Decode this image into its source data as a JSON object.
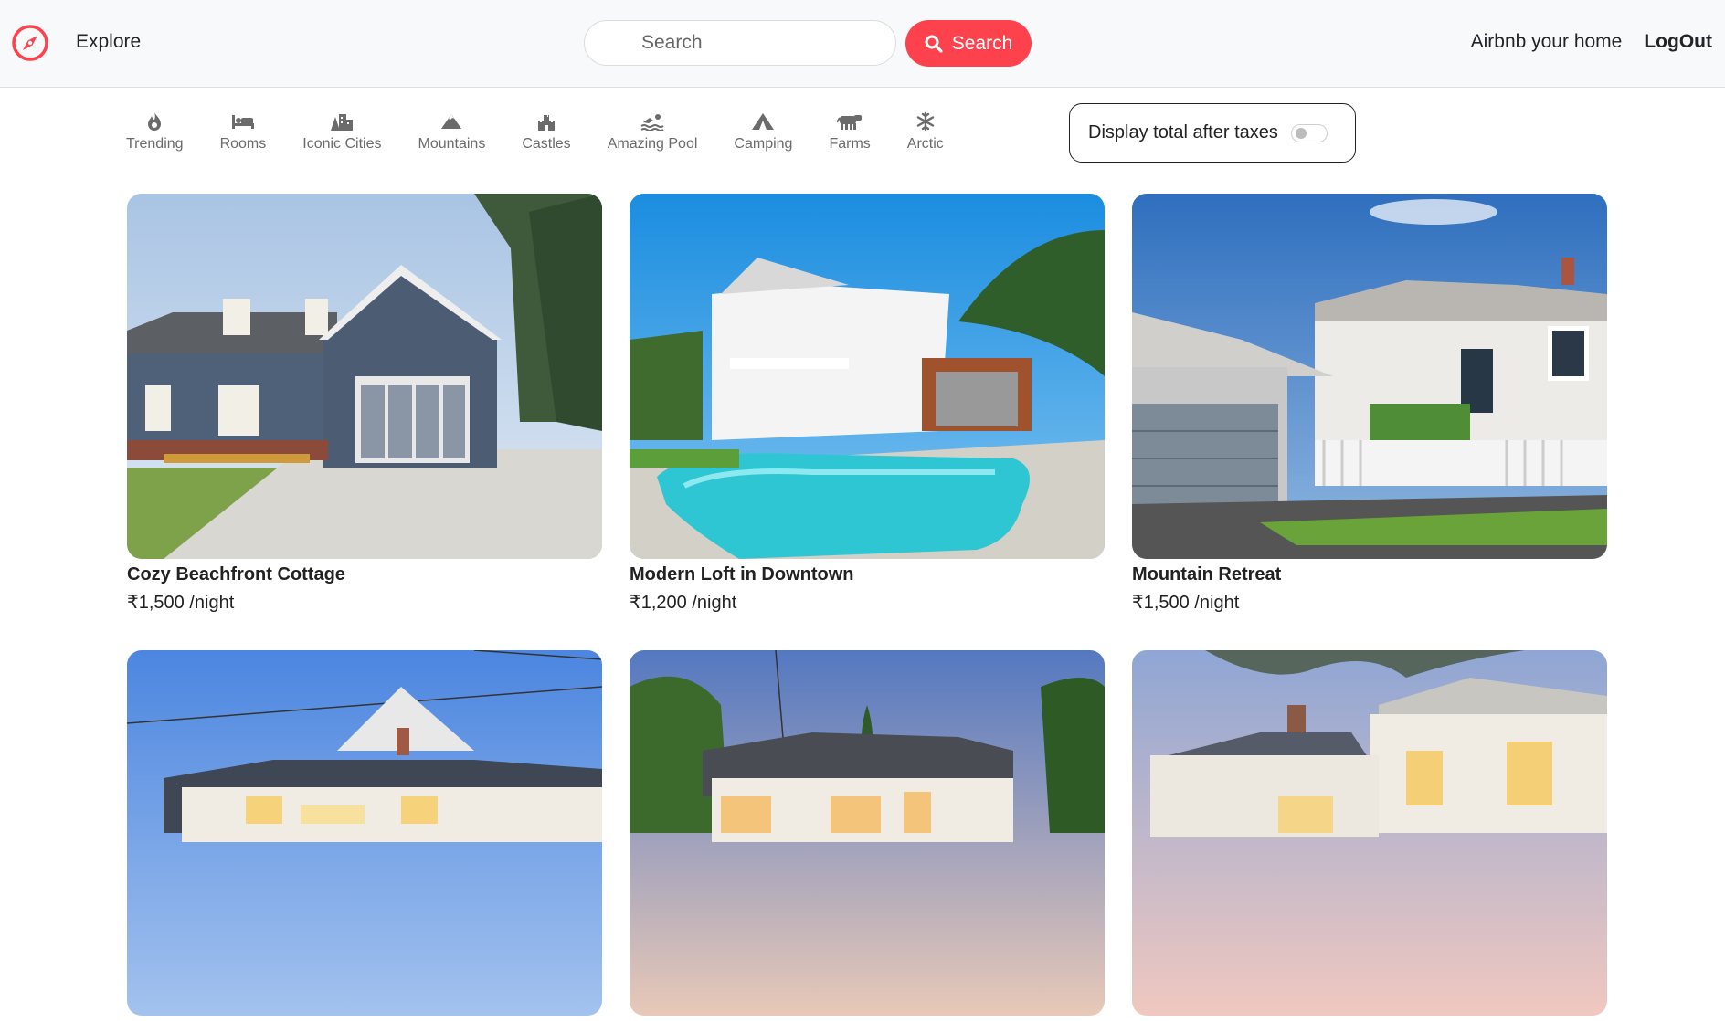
{
  "nav": {
    "explore": "Explore",
    "search_placeholder": "Search",
    "search_button": "Search",
    "host": "Airbnb your home",
    "logout": "LogOut"
  },
  "filters": [
    {
      "label": "Trending",
      "icon": "fire-icon"
    },
    {
      "label": "Rooms",
      "icon": "bed-icon"
    },
    {
      "label": "Iconic Cities",
      "icon": "city-icon"
    },
    {
      "label": "Mountains",
      "icon": "mountain-icon"
    },
    {
      "label": "Castles",
      "icon": "castle-icon"
    },
    {
      "label": "Amazing Pool",
      "icon": "swimmer-icon"
    },
    {
      "label": "Camping",
      "icon": "tent-icon"
    },
    {
      "label": "Farms",
      "icon": "cow-icon"
    },
    {
      "label": "Arctic",
      "icon": "snowflake-icon"
    }
  ],
  "tax_toggle": {
    "label": "Display total after taxes",
    "on": false
  },
  "listings": [
    {
      "title": "Cozy Beachfront Cottage",
      "price": "₹1,500 /night"
    },
    {
      "title": "Modern Loft in Downtown",
      "price": "₹1,200 /night"
    },
    {
      "title": "Mountain Retreat",
      "price": "₹1,500 /night"
    },
    {
      "title": "",
      "price": ""
    },
    {
      "title": "",
      "price": ""
    },
    {
      "title": "",
      "price": ""
    }
  ],
  "colors": {
    "brand": "#fe424d",
    "navbar_bg": "#f8f9fa",
    "filter_text": "#6b6b6b"
  }
}
